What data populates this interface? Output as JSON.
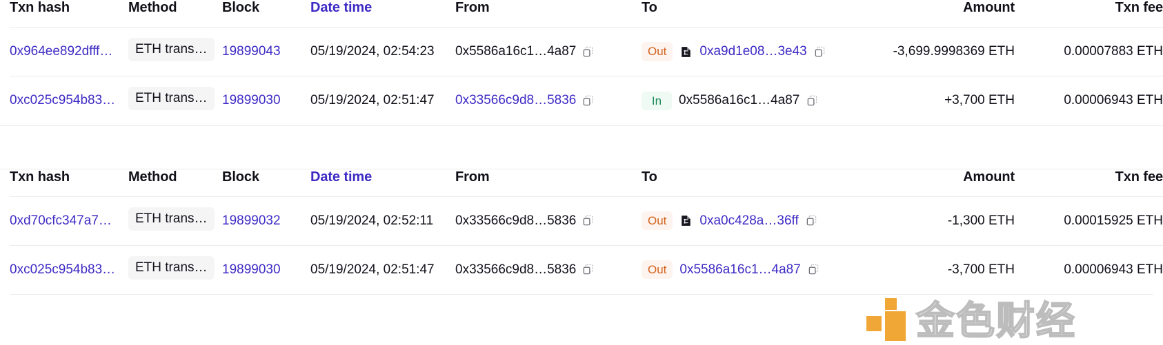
{
  "columns": {
    "txn_hash": "Txn hash",
    "method": "Method",
    "block": "Block",
    "date_time": "Date time",
    "from": "From",
    "to": "To",
    "amount": "Amount",
    "txn_fee": "Txn fee"
  },
  "colors": {
    "link": "#3d2bc4",
    "text": "#12111a",
    "out_badge_text": "#d4611a",
    "out_badge_bg": "#fdf4ef",
    "in_badge_text": "#1a8a5a",
    "in_badge_bg": "#eefaf3",
    "method_pill_bg": "#f5f5f6",
    "row_border": "#ececed",
    "watermark_orange": "#efa026"
  },
  "icons": {
    "copy": "copy-icon",
    "contract": "contract-icon"
  },
  "tables": [
    {
      "id": "table-1",
      "rows": [
        {
          "txn_hash": "0x964ee892dfff…",
          "method": "ETH trans…",
          "block": "19899043",
          "date_time": "05/19/2024, 02:54:23",
          "from": "0x5586a16c1…4a87",
          "from_is_link": false,
          "direction": "Out",
          "to": "0xa9d1e08…3e43",
          "to_is_link": true,
          "to_is_contract": true,
          "amount": "-3,699.9998369 ETH",
          "txn_fee": "0.00007883 ETH"
        },
        {
          "txn_hash": "0xc025c954b83…",
          "method": "ETH trans…",
          "block": "19899030",
          "date_time": "05/19/2024, 02:51:47",
          "from": "0x33566c9d8…5836",
          "from_is_link": true,
          "direction": "In",
          "to": "0x5586a16c1…4a87",
          "to_is_link": false,
          "to_is_contract": false,
          "amount": "+3,700 ETH",
          "txn_fee": "0.00006943 ETH"
        }
      ]
    },
    {
      "id": "table-2",
      "rows": [
        {
          "txn_hash": "0xd70cfc347a7…",
          "method": "ETH trans…",
          "block": "19899032",
          "date_time": "05/19/2024, 02:52:11",
          "from": "0x33566c9d8…5836",
          "from_is_link": false,
          "direction": "Out",
          "to": "0xa0c428a…36ff",
          "to_is_link": true,
          "to_is_contract": true,
          "amount": "-1,300 ETH",
          "txn_fee": "0.00015925 ETH"
        },
        {
          "txn_hash": "0xc025c954b83…",
          "method": "ETH trans…",
          "block": "19899030",
          "date_time": "05/19/2024, 02:51:47",
          "from": "0x33566c9d8…5836",
          "from_is_link": false,
          "direction": "Out",
          "to": "0x5586a16c1…4a87",
          "to_is_link": true,
          "to_is_contract": false,
          "amount": "-3,700 ETH",
          "txn_fee": "0.00006943 ETH"
        }
      ]
    }
  ],
  "watermark": {
    "text": "金色财经"
  }
}
